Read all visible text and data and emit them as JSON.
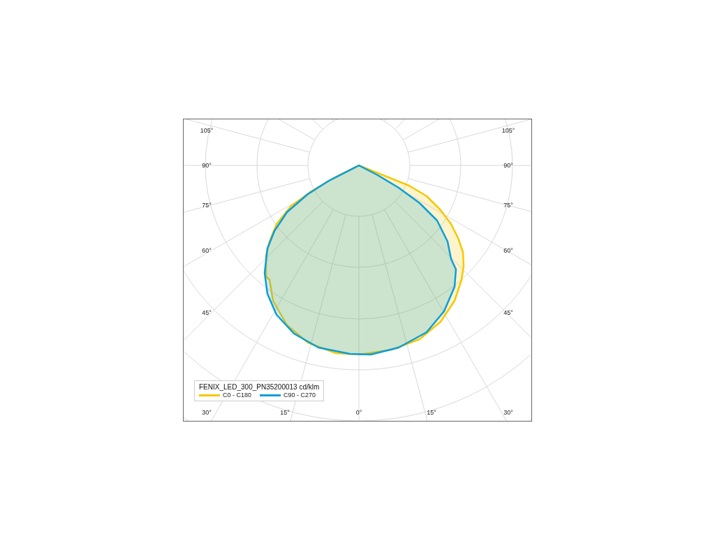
{
  "chart": {
    "title": "FENIX_LED_300_PN35200013  cd/klm",
    "angle_labels": {
      "left": [
        "105°",
        "90°",
        "75°",
        "60°",
        "45°"
      ],
      "right": [
        "105°",
        "90°",
        "75°",
        "60°",
        "45°"
      ],
      "bottom": [
        "30°",
        "15°",
        "0°",
        "15°",
        "30°"
      ]
    },
    "series": [
      {
        "name": "C0 - C180",
        "color": "#f5c800"
      },
      {
        "name": "C90 - C270",
        "color": "#0a9ed8"
      }
    ]
  }
}
